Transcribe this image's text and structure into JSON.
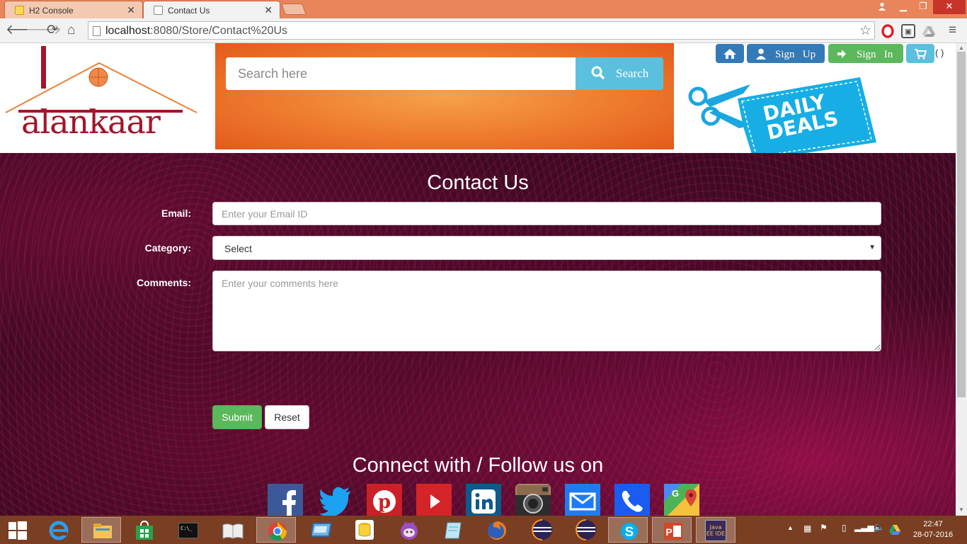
{
  "browser": {
    "tabs": [
      {
        "title": "H2 Console",
        "active": false
      },
      {
        "title": "Contact Us",
        "active": true
      }
    ],
    "address": {
      "host": "localhost",
      "path": ":8080/Store/Contact%20Us"
    },
    "accent": "#e8855a"
  },
  "header": {
    "logo_text": "alankaar",
    "search": {
      "placeholder": "Search here",
      "button_label": "Search"
    },
    "nav": {
      "sign_up": "Sign   Up",
      "sign_in": "Sign   In",
      "cart_count": "( )"
    },
    "deals_text": [
      "DAILY",
      "DEALS"
    ]
  },
  "contact_form": {
    "title": "Contact Us",
    "email": {
      "label": "Email:",
      "placeholder": "Enter your Email ID"
    },
    "category": {
      "label": "Category:",
      "selected": "Select"
    },
    "comments": {
      "label": "Comments:",
      "placeholder": "Enter your comments here"
    },
    "submit_label": "Submit",
    "reset_label": "Reset",
    "colors": {
      "submit": "#5cb85c",
      "search": "#5bc0de",
      "home": "#337ab7"
    }
  },
  "social": {
    "title": "Connect with / Follow us on",
    "icons": [
      "facebook-icon",
      "twitter-icon",
      "pinterest-icon",
      "youtube-icon",
      "linkedin-icon",
      "instagram-icon",
      "email-icon",
      "phone-icon",
      "google-maps-icon"
    ]
  },
  "taskbar": {
    "time": "22:47",
    "date": "28-07-2016",
    "java_ide_label": "Java EE IDE"
  }
}
